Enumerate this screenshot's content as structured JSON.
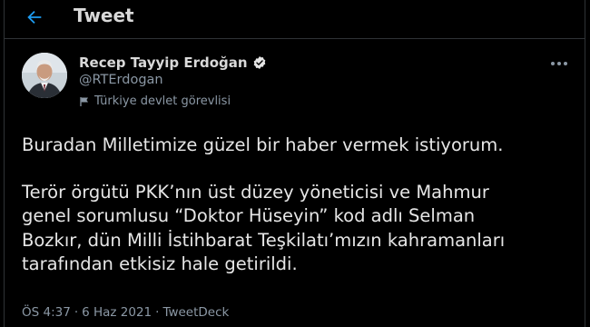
{
  "header": {
    "title": "Tweet",
    "back_icon": "arrow-left-icon"
  },
  "author": {
    "name": "Recep Tayyip Erdoğan",
    "handle": "@RTErdogan",
    "label": "Türkiye devlet görevlisi",
    "verified_icon": "verified-badge-icon",
    "label_icon": "flag-icon"
  },
  "menu_icon": "more-options-icon",
  "tweet": {
    "paragraph1": "Buradan Milletimize güzel bir haber vermek istiyorum.",
    "paragraph2_line1": "Terör örgütü PKK’nın üst düzey yöneticisi ve Mahmur",
    "paragraph2_line2": "genel sorumlusu “Doktor Hüseyin” kod adlı Selman",
    "paragraph2_line3": "Bozkır, dün Milli İstihbarat Teşkilatı’mızın kahramanları",
    "paragraph2_line4": "tarafından etkisiz hale getirildi."
  },
  "meta": {
    "time": "ÖS 4:37",
    "date": "6 Haz 2021",
    "source": "TweetDeck",
    "separator": "·"
  },
  "colors": {
    "background": "#000000",
    "text": "#d9d9d9",
    "secondary_text": "#8b98a5",
    "accent": "#1d9bf0",
    "border": "#2f3336"
  }
}
